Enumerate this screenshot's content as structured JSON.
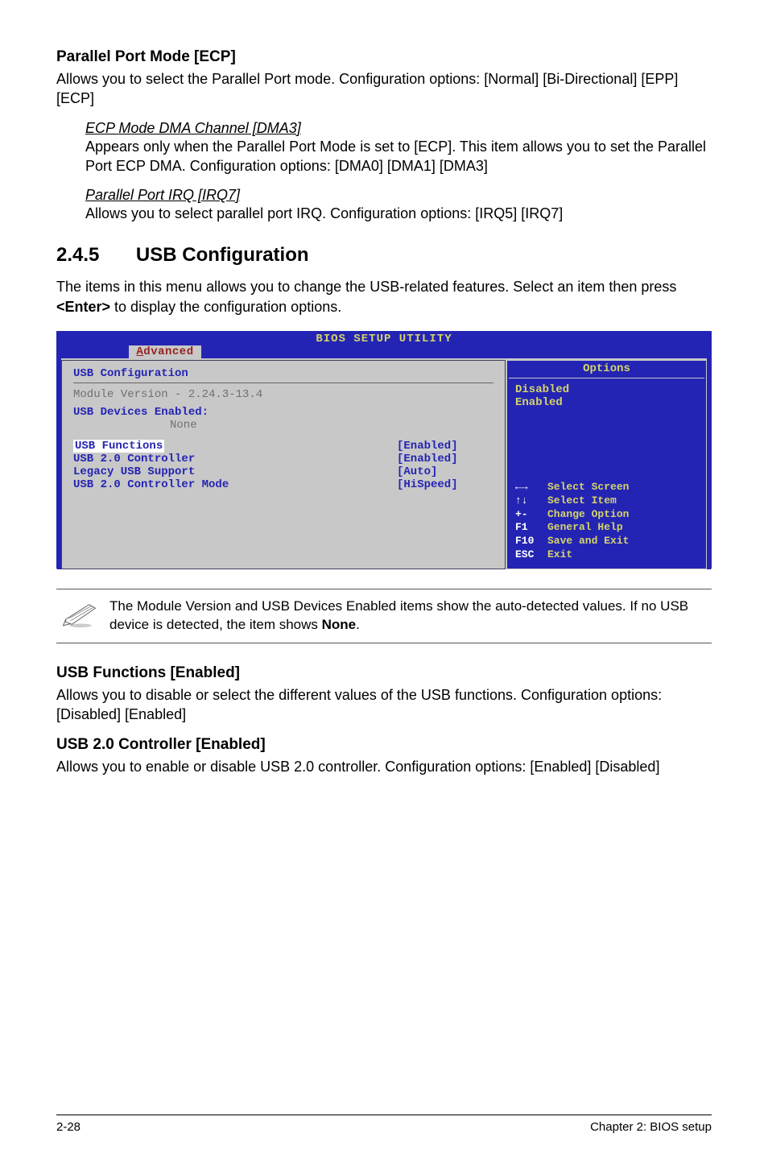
{
  "s1": {
    "h": "Parallel Port Mode [ECP]",
    "p": "Allows you to select the Parallel Port  mode. Configuration options: [Normal] [Bi-Directional] [EPP] [ECP]",
    "sub1h": "ECP Mode DMA Channel [DMA3]",
    "sub1p": "Appears only when the Parallel Port Mode is set to [ECP]. This item allows you to set the Parallel Port ECP DMA. Configuration options: [DMA0] [DMA1] [DMA3]",
    "sub2h": "Parallel Port IRQ [IRQ7]",
    "sub2p": "Allows you to select parallel port IRQ. Configuration options: [IRQ5] [IRQ7]"
  },
  "section": {
    "num": "2.4.5",
    "title": "USB Configuration"
  },
  "section_p1": "The items in this menu allows you to change the USB-related features. Select an item then press ",
  "section_p1b": "<Enter>",
  "section_p1c": " to display the configuration options.",
  "bios": {
    "title": "BIOS SETUP UTILITY",
    "tab_letter": "A",
    "tab_rest": "dvanced",
    "main_header": "USB Configuration",
    "mod_line": "Module Version - 2.24.3-13.4",
    "devhdr": "USB Devices Enabled:",
    "devnone": "None",
    "rows": [
      {
        "lbl": "USB Functions",
        "val": "[Enabled]",
        "sel": true
      },
      {
        "lbl": "USB 2.0 Controller",
        "val": "[Enabled]",
        "sel": false
      },
      {
        "lbl": "Legacy USB Support",
        "val": "[Auto]",
        "sel": false
      },
      {
        "lbl": "USB 2.0 Controller Mode",
        "val": "[HiSpeed]",
        "sel": false
      }
    ],
    "side_header": "Options",
    "opt1": "Disabled",
    "opt2": "Enabled",
    "nav": [
      {
        "k": "←→",
        "a": "Select Screen"
      },
      {
        "k": "↑↓",
        "a": "Select Item"
      },
      {
        "k": "+-",
        "a": "Change Option"
      },
      {
        "k": "F1",
        "a": "General Help"
      },
      {
        "k": "F10",
        "a": "Save and Exit"
      },
      {
        "k": "ESC",
        "a": "Exit"
      }
    ]
  },
  "note": {
    "t1": "The Module Version and USB Devices Enabled items show the auto-detected values. If no USB device is detected, the item shows ",
    "tb": "None",
    "t2": "."
  },
  "s2": {
    "h": "USB Functions [Enabled]",
    "p": "Allows you to disable or select the different values of the USB functions. Configuration options: [Disabled] [Enabled]"
  },
  "s3": {
    "h": "USB 2.0 Controller [Enabled]",
    "p": "Allows you to enable or disable USB 2.0 controller. Configuration options: [Enabled] [Disabled]"
  },
  "footer": {
    "left": "2-28",
    "right": "Chapter 2: BIOS setup"
  }
}
